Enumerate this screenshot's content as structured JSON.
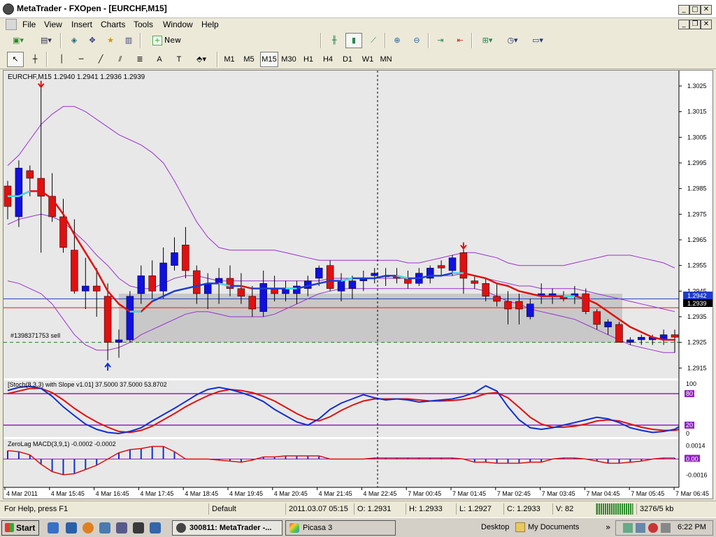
{
  "window": {
    "title": "300811: MetaTrader - FXOpen - [EURCHF,M15]",
    "title_shown": "MetaTrader - FXOpen - [EURCHF,M15]"
  },
  "menu": [
    "File",
    "View",
    "Insert",
    "Charts",
    "Tools",
    "Window",
    "Help"
  ],
  "toolbar": {
    "new_order_label": "New Order",
    "timeframes": [
      "M1",
      "M5",
      "M15",
      "M30",
      "H1",
      "H4",
      "D1",
      "W1",
      "MN"
    ],
    "active_timeframe": "M15"
  },
  "chart": {
    "header": "EURCHF,M15  1.2940 1.2941 1.2936 1.2939",
    "order_label": "#1398371753 sell",
    "bid_price": "1.2942",
    "ask_price": "1.2939",
    "price_ticks": [
      "1.3025",
      "1.3015",
      "1.3005",
      "1.2995",
      "1.2985",
      "1.2975",
      "1.2965",
      "1.2955",
      "1.2945",
      "1.2935",
      "1.2925",
      "1.2915"
    ],
    "time_labels": [
      "4 Mar 2011",
      "4 Mar 15:45",
      "4 Mar 16:45",
      "4 Mar 17:45",
      "4 Mar 18:45",
      "4 Mar 19:45",
      "4 Mar 20:45",
      "4 Mar 21:45",
      "4 Mar 22:45",
      "7 Mar 00:45",
      "7 Mar 01:45",
      "7 Mar 02:45",
      "7 Mar 03:45",
      "7 Mar 04:45",
      "7 Mar 05:45",
      "7 Mar 06:45"
    ],
    "stoch_header": "[Stoch(8,3,3) with Slope v1.01] 37.5000 37.5000 53.8702",
    "stoch_ticks": [
      "100",
      "80",
      "20",
      "0"
    ],
    "macd_header": "ZeroLag MACD(3,9,1) -0.0002 -0.0002",
    "macd_ticks": [
      "0.0014",
      "0.00",
      "-0.0016"
    ],
    "colors": {
      "bull": "#1010e0",
      "bear": "#e01010",
      "band": "#9b30d0",
      "ma": "#e01010",
      "ma_cyan": "#40e0e0",
      "zone": "#c8c8c8",
      "bg": "#e8e8e8"
    }
  },
  "chart_data": {
    "type": "candlestick",
    "symbol": "EURCHF",
    "timeframe": "M15",
    "ylim": [
      1.2911,
      1.3031
    ],
    "candles": [
      {
        "o": 1.2986,
        "h": 1.2988,
        "l": 1.2973,
        "c": 1.2978
      },
      {
        "o": 1.2974,
        "h": 1.2996,
        "l": 1.297,
        "c": 1.2993
      },
      {
        "o": 1.2992,
        "h": 1.2994,
        "l": 1.2982,
        "c": 1.2989
      },
      {
        "o": 1.2989,
        "h": 1.3025,
        "l": 1.296,
        "c": 1.2982
      },
      {
        "o": 1.2982,
        "h": 1.2991,
        "l": 1.2972,
        "c": 1.2974
      },
      {
        "o": 1.2974,
        "h": 1.2981,
        "l": 1.296,
        "c": 1.2962
      },
      {
        "o": 1.2961,
        "h": 1.2973,
        "l": 1.2944,
        "c": 1.2945
      },
      {
        "o": 1.2945,
        "h": 1.2958,
        "l": 1.2938,
        "c": 1.2947
      },
      {
        "o": 1.2947,
        "h": 1.2954,
        "l": 1.2935,
        "c": 1.2945
      },
      {
        "o": 1.2943,
        "h": 1.2948,
        "l": 1.2918,
        "c": 1.2925
      },
      {
        "o": 1.2925,
        "h": 1.293,
        "l": 1.2919,
        "c": 1.2926
      },
      {
        "o": 1.2926,
        "h": 1.2945,
        "l": 1.2925,
        "c": 1.2943
      },
      {
        "o": 1.2944,
        "h": 1.2955,
        "l": 1.294,
        "c": 1.2951
      },
      {
        "o": 1.2951,
        "h": 1.2957,
        "l": 1.2942,
        "c": 1.2945
      },
      {
        "o": 1.2945,
        "h": 1.2962,
        "l": 1.2942,
        "c": 1.2956
      },
      {
        "o": 1.2955,
        "h": 1.2966,
        "l": 1.2953,
        "c": 1.296
      },
      {
        "o": 1.2963,
        "h": 1.297,
        "l": 1.295,
        "c": 1.2953
      },
      {
        "o": 1.2953,
        "h": 1.2955,
        "l": 1.294,
        "c": 1.2944
      },
      {
        "o": 1.2944,
        "h": 1.2952,
        "l": 1.2938,
        "c": 1.2948
      },
      {
        "o": 1.2948,
        "h": 1.2954,
        "l": 1.294,
        "c": 1.295
      },
      {
        "o": 1.295,
        "h": 1.2955,
        "l": 1.2943,
        "c": 1.2946
      },
      {
        "o": 1.2946,
        "h": 1.2952,
        "l": 1.294,
        "c": 1.2943
      },
      {
        "o": 1.2943,
        "h": 1.2947,
        "l": 1.2935,
        "c": 1.2938
      },
      {
        "o": 1.2937,
        "h": 1.2953,
        "l": 1.2935,
        "c": 1.2948
      },
      {
        "o": 1.2946,
        "h": 1.2951,
        "l": 1.2941,
        "c": 1.2944
      },
      {
        "o": 1.2944,
        "h": 1.2949,
        "l": 1.2941,
        "c": 1.2946
      },
      {
        "o": 1.2944,
        "h": 1.2949,
        "l": 1.294,
        "c": 1.2947
      },
      {
        "o": 1.2946,
        "h": 1.2951,
        "l": 1.2943,
        "c": 1.2949
      },
      {
        "o": 1.295,
        "h": 1.2955,
        "l": 1.2947,
        "c": 1.2954
      },
      {
        "o": 1.2955,
        "h": 1.2957,
        "l": 1.2945,
        "c": 1.2946
      },
      {
        "o": 1.2945,
        "h": 1.2952,
        "l": 1.2941,
        "c": 1.2949
      },
      {
        "o": 1.2946,
        "h": 1.2951,
        "l": 1.2942,
        "c": 1.2949
      },
      {
        "o": 1.2949,
        "h": 1.2953,
        "l": 1.2945,
        "c": 1.295
      },
      {
        "o": 1.2951,
        "h": 1.2954,
        "l": 1.2948,
        "c": 1.2952
      },
      {
        "o": 1.2951,
        "h": 1.2954,
        "l": 1.2947,
        "c": 1.2951
      },
      {
        "o": 1.2951,
        "h": 1.2954,
        "l": 1.2948,
        "c": 1.295
      },
      {
        "o": 1.295,
        "h": 1.2953,
        "l": 1.2946,
        "c": 1.2948
      },
      {
        "o": 1.2948,
        "h": 1.2954,
        "l": 1.2947,
        "c": 1.2952
      },
      {
        "o": 1.295,
        "h": 1.2955,
        "l": 1.2948,
        "c": 1.2954
      },
      {
        "o": 1.2955,
        "h": 1.2957,
        "l": 1.2951,
        "c": 1.2954
      },
      {
        "o": 1.2953,
        "h": 1.2959,
        "l": 1.2951,
        "c": 1.2958
      },
      {
        "o": 1.296,
        "h": 1.2962,
        "l": 1.2944,
        "c": 1.295
      },
      {
        "o": 1.2949,
        "h": 1.2951,
        "l": 1.2946,
        "c": 1.2948
      },
      {
        "o": 1.2948,
        "h": 1.295,
        "l": 1.2941,
        "c": 1.2943
      },
      {
        "o": 1.2943,
        "h": 1.2948,
        "l": 1.2939,
        "c": 1.2941
      },
      {
        "o": 1.2941,
        "h": 1.2945,
        "l": 1.2932,
        "c": 1.2938
      },
      {
        "o": 1.2941,
        "h": 1.2944,
        "l": 1.2932,
        "c": 1.2938
      },
      {
        "o": 1.2935,
        "h": 1.2942,
        "l": 1.2934,
        "c": 1.294
      },
      {
        "o": 1.2943,
        "h": 1.2948,
        "l": 1.294,
        "c": 1.2944
      },
      {
        "o": 1.2943,
        "h": 1.2946,
        "l": 1.294,
        "c": 1.2944
      },
      {
        "o": 1.2943,
        "h": 1.2945,
        "l": 1.2941,
        "c": 1.2942
      },
      {
        "o": 1.2943,
        "h": 1.2947,
        "l": 1.294,
        "c": 1.2944
      },
      {
        "o": 1.2944,
        "h": 1.2946,
        "l": 1.2936,
        "c": 1.2937
      },
      {
        "o": 1.2937,
        "h": 1.2938,
        "l": 1.293,
        "c": 1.2932
      },
      {
        "o": 1.2931,
        "h": 1.2934,
        "l": 1.2928,
        "c": 1.2933
      },
      {
        "o": 1.2932,
        "h": 1.2933,
        "l": 1.2925,
        "c": 1.2925
      },
      {
        "o": 1.2925,
        "h": 1.2927,
        "l": 1.2924,
        "c": 1.2926
      },
      {
        "o": 1.2926,
        "h": 1.2928,
        "l": 1.2924,
        "c": 1.2927
      },
      {
        "o": 1.2926,
        "h": 1.2928,
        "l": 1.2924,
        "c": 1.2927
      },
      {
        "o": 1.2926,
        "h": 1.293,
        "l": 1.2924,
        "c": 1.2928
      },
      {
        "o": 1.2928,
        "h": 1.293,
        "l": 1.2921,
        "c": 1.2927
      }
    ],
    "ma": [
      1.2982,
      1.2982,
      1.2984,
      1.2984,
      1.2981,
      1.2975,
      1.2967,
      1.296,
      1.2953,
      1.2945,
      1.294,
      1.2937,
      1.2937,
      1.2941,
      1.2943,
      1.2945,
      1.2946,
      1.2947,
      1.2948,
      1.2948,
      1.2947,
      1.2947,
      1.2946,
      1.2946,
      1.2946,
      1.2946,
      1.2946,
      1.2947,
      1.2948,
      1.2949,
      1.2949,
      1.295,
      1.295,
      1.295,
      1.2951,
      1.2951,
      1.295,
      1.295,
      1.2951,
      1.2951,
      1.2952,
      1.2952,
      1.2951,
      1.295,
      1.2948,
      1.2947,
      1.2945,
      1.2944,
      1.2943,
      1.2943,
      1.2943,
      1.2943,
      1.2942,
      1.294,
      1.2937,
      1.2934,
      1.2931,
      1.2929,
      1.2927,
      1.2926,
      1.2926
    ],
    "band_upper": [
      1.2994,
      1.2998,
      1.3004,
      1.301,
      1.3014,
      1.3017,
      1.3017,
      1.3015,
      1.3012,
      1.3009,
      1.3006,
      1.3004,
      1.3002,
      1.2999,
      1.2995,
      1.2988,
      1.298,
      1.2972,
      1.2966,
      1.2962,
      1.2961,
      1.2961,
      1.2961,
      1.2961,
      1.2961,
      1.296,
      1.2959,
      1.2958,
      1.2957,
      1.2957,
      1.2957,
      1.2957,
      1.2957,
      1.2957,
      1.2957,
      1.2957,
      1.2956,
      1.2956,
      1.2957,
      1.2958,
      1.2959,
      1.296,
      1.296,
      1.2959,
      1.2958,
      1.2956,
      1.2955,
      1.2955,
      1.2955,
      1.2955,
      1.2955,
      1.2956,
      1.2957,
      1.2958,
      1.2959,
      1.2959,
      1.2959,
      1.2958,
      1.2957,
      1.2956,
      1.2954
    ],
    "band_mid": [
      1.2971,
      1.2973,
      1.2974,
      1.2975,
      1.2974,
      1.2972,
      1.2968,
      1.2964,
      1.2959,
      1.2955,
      1.295,
      1.2947,
      1.2946,
      1.2946,
      1.2948,
      1.295,
      1.2951,
      1.2951,
      1.295,
      1.2949,
      1.2949,
      1.2949,
      1.2949,
      1.2949,
      1.2949,
      1.2949,
      1.2949,
      1.2949,
      1.2949,
      1.295,
      1.295,
      1.295,
      1.295,
      1.295,
      1.295,
      1.295,
      1.295,
      1.295,
      1.2951,
      1.2951,
      1.2951,
      1.2952,
      1.2951,
      1.295,
      1.2949,
      1.2948,
      1.2947,
      1.2947,
      1.2946,
      1.2946,
      1.2946,
      1.2946,
      1.2945,
      1.2944,
      1.2943,
      1.2942,
      1.2941,
      1.294,
      1.2939,
      1.2938,
      1.2937
    ],
    "band_lower": [
      1.2949,
      1.2948,
      1.2946,
      1.2944,
      1.294,
      1.2934,
      1.2928,
      1.2924,
      1.2922,
      1.2922,
      1.2923,
      1.2925,
      1.2928,
      1.293,
      1.2932,
      1.2934,
      1.2936,
      1.2937,
      1.2937,
      1.2936,
      1.2935,
      1.2935,
      1.2935,
      1.2935,
      1.2936,
      1.2938,
      1.294,
      1.2942,
      1.2944,
      1.2945,
      1.2946,
      1.2946,
      1.2946,
      1.2946,
      1.2946,
      1.2946,
      1.2946,
      1.2946,
      1.2946,
      1.2946,
      1.2946,
      1.2946,
      1.2946,
      1.2945,
      1.2943,
      1.2941,
      1.294,
      1.2938,
      1.2937,
      1.2936,
      1.2935,
      1.2934,
      1.2932,
      1.293,
      1.2928,
      1.2926,
      1.2924,
      1.2923,
      1.2922,
      1.2921,
      1.2921
    ],
    "stoch_main": [
      86,
      92,
      94,
      90,
      75,
      55,
      38,
      22,
      12,
      6,
      4,
      8,
      15,
      28,
      40,
      52,
      65,
      78,
      88,
      92,
      88,
      82,
      75,
      65,
      50,
      38,
      26,
      20,
      32,
      50,
      62,
      70,
      78,
      72,
      68,
      70,
      68,
      64,
      66,
      68,
      70,
      75,
      82,
      95,
      85,
      55,
      30,
      15,
      12,
      15,
      20,
      25,
      30,
      35,
      32,
      25,
      15,
      10,
      6,
      8,
      12,
      25
    ],
    "stoch_signal": [
      80,
      85,
      90,
      90,
      82,
      68,
      52,
      38,
      26,
      16,
      8,
      6,
      10,
      18,
      30,
      42,
      55,
      66,
      76,
      84,
      88,
      86,
      82,
      75,
      66,
      54,
      42,
      32,
      28,
      36,
      48,
      58,
      66,
      70,
      70,
      70,
      70,
      68,
      66,
      66,
      67,
      69,
      73,
      80,
      82,
      72,
      54,
      35,
      22,
      16,
      16,
      18,
      22,
      28,
      30,
      28,
      22,
      16,
      12,
      10,
      10,
      15
    ],
    "macd_hist": [
      0.0008,
      0.0007,
      0.0004,
      -0.0005,
      -0.0012,
      -0.0015,
      -0.0014,
      -0.001,
      -0.0006,
      0.0,
      0.0006,
      0.0009,
      0.001,
      0.0012,
      0.0012,
      0.0007,
      0.0,
      0.0,
      0.0,
      -0.0001,
      -0.0002,
      -0.0003,
      -0.0001,
      0.0002,
      0.0002,
      0.0003,
      0.0003,
      0.0003,
      0.0003,
      0.0,
      0.0,
      0.0,
      0.0,
      0.0001,
      0.0001,
      0.0001,
      0.0001,
      0.0001,
      0.0001,
      0.0001,
      0.0001,
      0.0,
      -0.0003,
      -0.0003,
      -0.0004,
      -0.0004,
      -0.0004,
      -0.0003,
      -0.0003,
      0.0,
      0.0001,
      0.0001,
      0.0,
      -0.0002,
      -0.0004,
      -0.0004,
      -0.0003,
      -0.0002,
      0.0,
      0.0001,
      0.0001
    ]
  },
  "status": {
    "help": "For Help, press F1",
    "profile": "Default",
    "datetime": "2011.03.07 05:15",
    "open": "O: 1.2931",
    "high": "H: 1.2933",
    "low": "L: 1.2927",
    "close": "C: 1.2933",
    "volume": "V: 82",
    "traffic": "3276/5 kb"
  },
  "taskbar": {
    "start": "Start",
    "tasks": [
      "300811: MetaTrader -...",
      "Picasa 3"
    ],
    "desktop": "Desktop",
    "mydocs": "My Documents",
    "clock": "6:22 PM"
  }
}
